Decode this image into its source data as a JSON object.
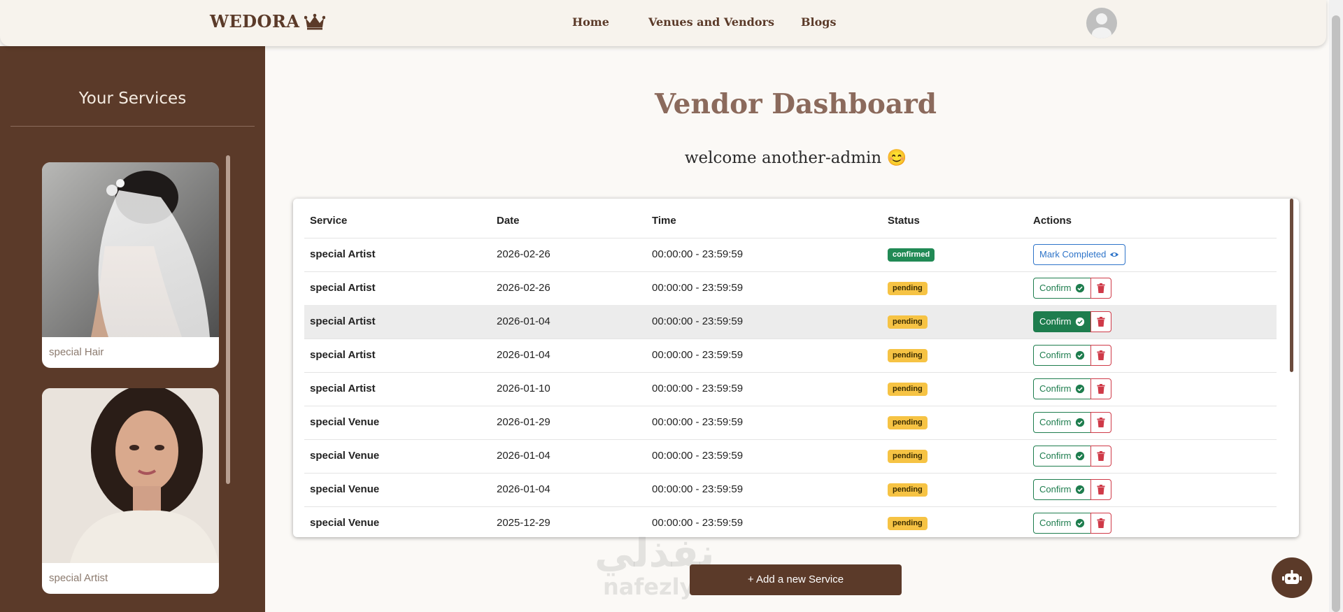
{
  "navbar": {
    "brand": "WEDORA",
    "links": [
      "Home",
      "Venues and Vendors",
      "Blogs"
    ]
  },
  "sidebar": {
    "title": "Your Services",
    "cards": [
      {
        "label": "special Hair"
      },
      {
        "label": "special Artist"
      }
    ]
  },
  "main": {
    "title": "Vendor Dashboard",
    "welcome": "welcome another-admin 😊",
    "add_button": "+ Add a new Service"
  },
  "table": {
    "headers": [
      "Service",
      "Date",
      "Time",
      "Status",
      "Actions"
    ],
    "rows": [
      {
        "service": "special Artist",
        "date": "2026-02-26",
        "time": "00:00:00 - 23:59:59",
        "status": "confirmed",
        "action": "Mark Completed"
      },
      {
        "service": "special Artist",
        "date": "2026-02-26",
        "time": "00:00:00 - 23:59:59",
        "status": "pending",
        "action": "Confirm"
      },
      {
        "service": "special Artist",
        "date": "2026-01-04",
        "time": "00:00:00 - 23:59:59",
        "status": "pending",
        "action": "Confirm"
      },
      {
        "service": "special Artist",
        "date": "2026-01-04",
        "time": "00:00:00 - 23:59:59",
        "status": "pending",
        "action": "Confirm"
      },
      {
        "service": "special Artist",
        "date": "2026-01-10",
        "time": "00:00:00 - 23:59:59",
        "status": "pending",
        "action": "Confirm"
      },
      {
        "service": "special Venue",
        "date": "2026-01-29",
        "time": "00:00:00 - 23:59:59",
        "status": "pending",
        "action": "Confirm"
      },
      {
        "service": "special Venue",
        "date": "2026-01-04",
        "time": "00:00:00 - 23:59:59",
        "status": "pending",
        "action": "Confirm"
      },
      {
        "service": "special Venue",
        "date": "2026-01-04",
        "time": "00:00:00 - 23:59:59",
        "status": "pending",
        "action": "Confirm"
      },
      {
        "service": "special Venue",
        "date": "2025-12-29",
        "time": "00:00:00 - 23:59:59",
        "status": "pending",
        "action": "Confirm"
      }
    ]
  },
  "watermark": {
    "arabic": "نفذلي",
    "latin": "nafezly.com"
  },
  "colors": {
    "brand_brown": "#5b3a29",
    "title_brown": "#8b6a5c",
    "pending": "#f6c344",
    "confirmed": "#218a55",
    "confirm_green": "#1e7d4e",
    "delete_red": "#cf3a48",
    "mark_blue": "#2e74c9"
  },
  "icons": {
    "brand": "crown-icon",
    "avatar": "user-avatar-icon",
    "confirm": "check-circle-icon",
    "delete": "trash-icon",
    "mark": "eye-icon",
    "bot": "robot-icon"
  }
}
